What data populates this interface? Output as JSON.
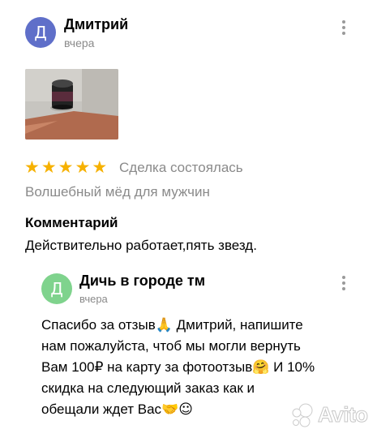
{
  "review": {
    "avatar_letter": "Д",
    "avatar_color": "#5f6fc9",
    "author": "Дмитрий",
    "date": "вчера",
    "rating": 5,
    "stars": "★★★★★",
    "status": "Сделка состоялась",
    "product": "Волшебный мёд для мужчин",
    "comment_heading": "Комментарий",
    "comment": "Действительно работает,пять звезд."
  },
  "reply": {
    "avatar_letter": "Д",
    "avatar_color": "#7fd38d",
    "author": "Дичь в городе тм",
    "date": "вчера",
    "text_lines": [
      "Спасибо за отзыв",
      " Дмитрий, напишите",
      "нам пожалуйста, чтоб мы могли вернуть",
      "Вам 100₽ на карту за фотоотзыв",
      " И 10%",
      "скидка на следующий заказ как и",
      "обещали ждет Вас"
    ],
    "emojis": [
      "🙏",
      "🤗",
      "🤝",
      "☺"
    ]
  },
  "watermark": {
    "brand": "Avito"
  },
  "colors": {
    "star": "#f6b100",
    "muted_text": "#8a8a8a"
  }
}
